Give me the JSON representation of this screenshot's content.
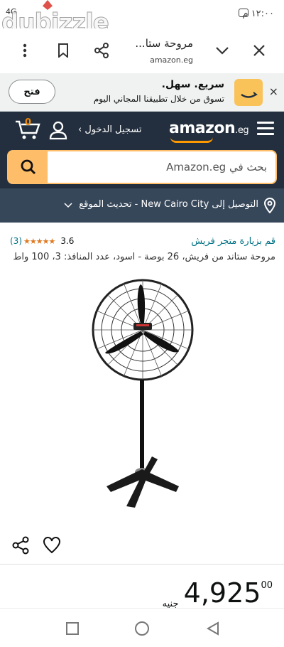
{
  "status_bar": {
    "time": "١٢:٠٠ م",
    "network": "4G"
  },
  "watermark": "dubizzle",
  "browser": {
    "page_title": "مروحة ستا...",
    "url": "amazon.eg"
  },
  "app_banner": {
    "title": "سريع. سهل.",
    "subtitle": "تسوق من خلال تطبيقنا المجاني اليوم",
    "open_label": "فتح",
    "close_symbol": "×"
  },
  "header": {
    "logo": "amazon",
    "logo_suffix": ".eg",
    "sign_in": "تسجيل الدخول ›",
    "cart_count": "0"
  },
  "search": {
    "placeholder": "بحث في Amazon.eg"
  },
  "delivery": {
    "text": "التوصيل إلى New Cairo City - تحديث الموقع"
  },
  "product": {
    "store_link": "قم بزيارة متجر فريش",
    "rating_value": "3.6",
    "stars": "★★★★★",
    "rating_count": "(3)",
    "title": "مروحة ستاند من فريش، 26 بوصة - اسود، عدد المنافذ: 3، 100 واط",
    "price_whole": "4,925",
    "price_fraction": "00",
    "currency": "جنيه"
  },
  "colors": {
    "header_bg": "#232f3e",
    "subnav_bg": "#37475a",
    "accent": "#febd69",
    "link": "#007185",
    "star": "#de7921"
  }
}
